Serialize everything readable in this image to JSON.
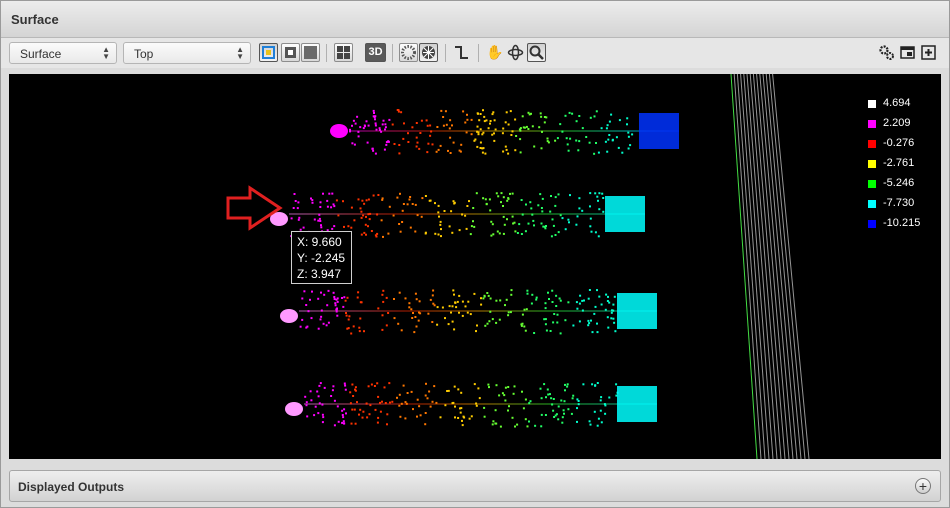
{
  "window": {
    "title": "Surface"
  },
  "toolbar": {
    "display_select": {
      "value": "Surface"
    },
    "view_select": {
      "value": "Top"
    },
    "view_3d_label": "3D",
    "tools": [
      "color-map-icon",
      "grayscale-icon",
      "solid-icon",
      "grid-icon",
      "3d-button",
      "mesh-icon",
      "wireframe-icon",
      "profile-icon",
      "pan-hand-icon",
      "rotate-icon",
      "zoom-icon"
    ],
    "right_tools": [
      "settings-icon",
      "window-icon",
      "add-icon"
    ]
  },
  "legend": [
    {
      "label": "4.694",
      "color": "#ffffff"
    },
    {
      "label": "2.209",
      "color": "#ff00ff"
    },
    {
      "label": "-0.276",
      "color": "#ff0000"
    },
    {
      "label": "-2.761",
      "color": "#ffff00"
    },
    {
      "label": "-5.246",
      "color": "#00ff00"
    },
    {
      "label": "-7.730",
      "color": "#00ffff"
    },
    {
      "label": "-10.215",
      "color": "#0000ff"
    }
  ],
  "tooltip": {
    "x": "X: 9.660",
    "y": "Y: -2.245",
    "z": "Z: 3.947"
  },
  "bottom_panel": {
    "label": "Displayed Outputs"
  }
}
